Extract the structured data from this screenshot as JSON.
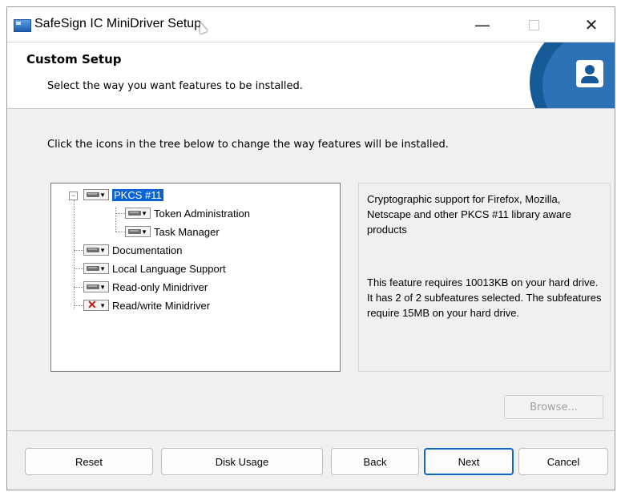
{
  "window": {
    "title": "SafeSign IC MiniDriver Setup",
    "min_glyph": "—",
    "close_glyph": "✕"
  },
  "header": {
    "title": "Custom Setup",
    "subtitle": "Select the way you want features to be installed."
  },
  "instruction": "Click the icons in the tree below to change the way features will be installed.",
  "tree": {
    "root": {
      "label": "PKCS #11",
      "expander": "−"
    },
    "children": [
      {
        "label": "Token Administration"
      },
      {
        "label": "Task Manager"
      }
    ],
    "siblings": [
      {
        "label": "Documentation"
      },
      {
        "label": "Local Language Support"
      },
      {
        "label": "Read-only Minidriver"
      },
      {
        "label": "Read/write Minidriver"
      }
    ]
  },
  "description": {
    "summary": "Cryptographic support for Firefox, Mozilla, Netscape and other PKCS #11 library aware products",
    "requirements": "This feature requires 10013KB on your hard drive. It has 2 of 2 subfeatures selected. The subfeatures require 15MB on your hard drive."
  },
  "buttons": {
    "browse": "Browse...",
    "reset": "Reset",
    "disk_usage": "Disk Usage",
    "back": "Back",
    "next": "Next",
    "cancel": "Cancel"
  },
  "colors": {
    "selection": "#0a64d6",
    "brand_blue": "#175a98",
    "primary_border": "#0f67c8",
    "unavailable_x": "#cc1111"
  },
  "icons": {
    "feature_state": "drive-icon",
    "unavailable_state": "x-icon",
    "app": "setup-icon"
  }
}
